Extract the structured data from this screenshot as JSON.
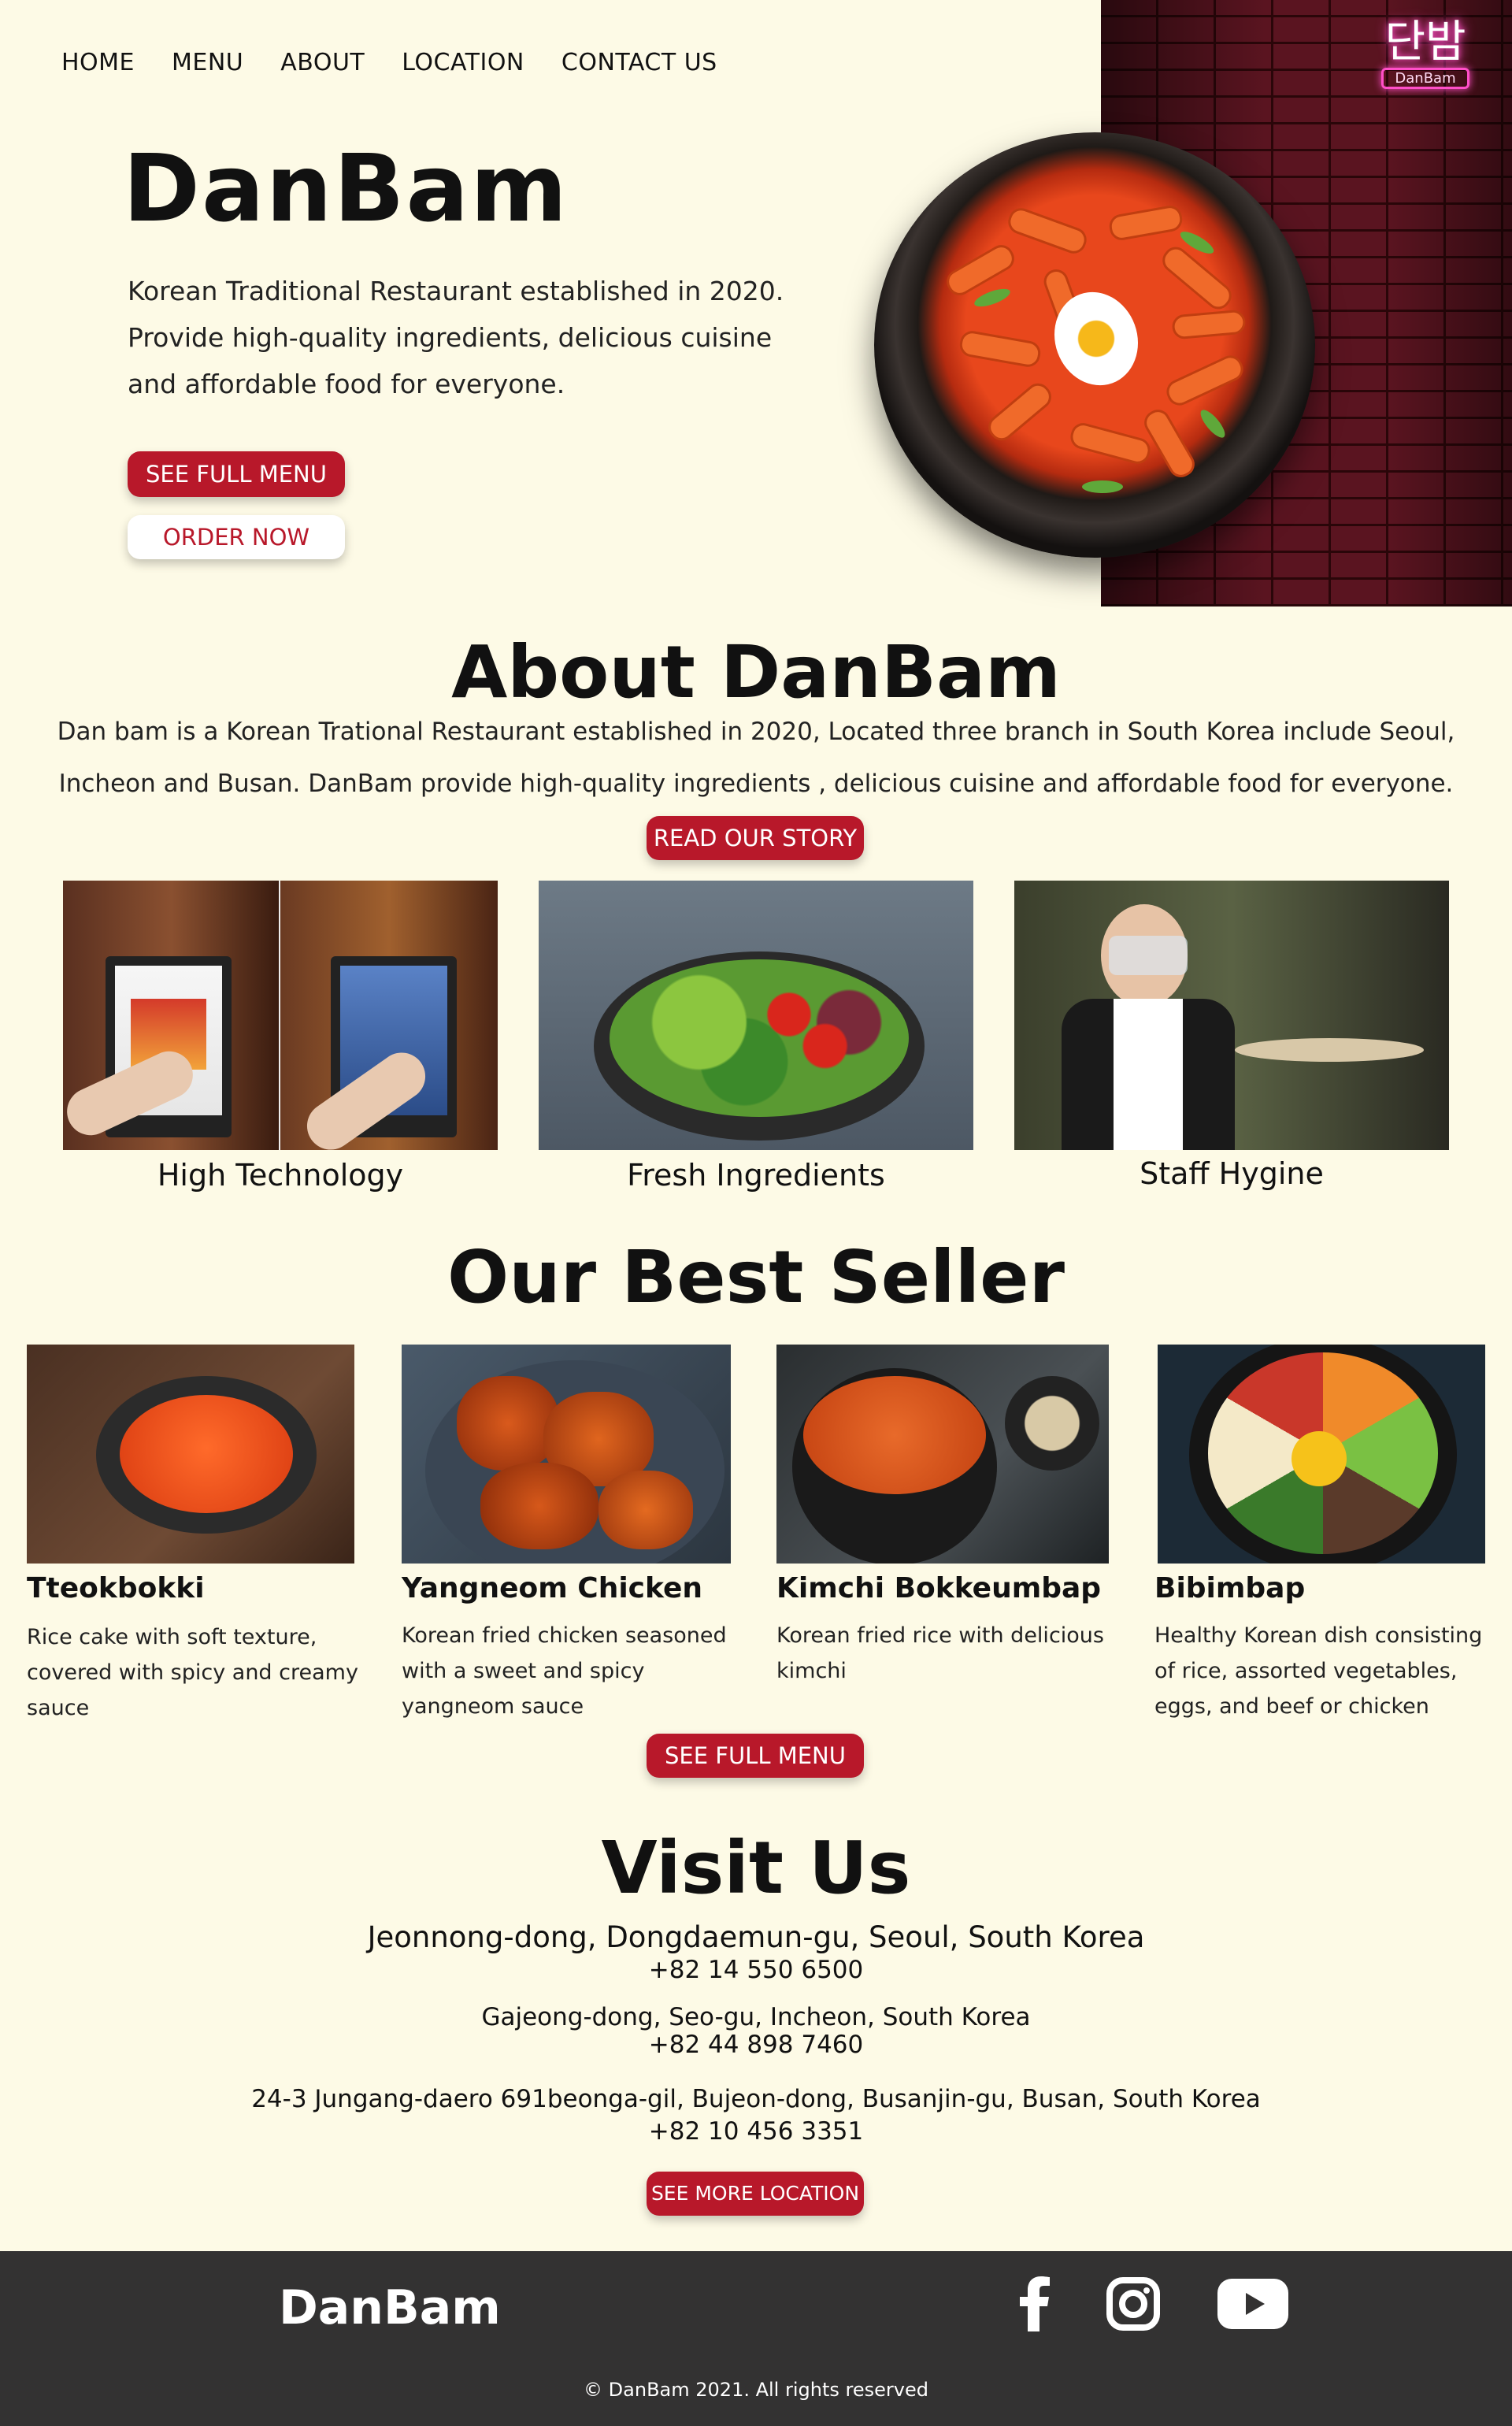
{
  "nav": {
    "items": [
      "HOME",
      "MENU",
      "ABOUT",
      "LOCATION",
      "CONTACT US"
    ]
  },
  "hero": {
    "logo_korean": "단밤",
    "logo_tag": "DanBam",
    "brand": "DanBam",
    "lede": [
      "Korean Traditional Restaurant established in 2020.",
      "Provide high-quality ingredients, delicious cuisine",
      "and affordable food for everyone."
    ],
    "btn_menu": "SEE FULL MENU",
    "btn_order": "ORDER NOW"
  },
  "about": {
    "title": "About DanBam",
    "lines": [
      "Dan bam is a Korean Trational Restaurant established in 2020,  Located three branch in South Korea include Seoul,",
      "Incheon and Busan. DanBam provide high-quality ingredients , delicious cuisine and affordable food for everyone."
    ],
    "btn": "READ OUR STORY",
    "features": [
      "High Technology",
      "Fresh Ingredients",
      "Staff Hygine"
    ]
  },
  "best": {
    "title": "Our Best Seller",
    "items": [
      {
        "name": "Tteokbokki",
        "desc": "Rice cake with soft texture, covered with spicy and creamy sauce"
      },
      {
        "name": "Yangneom Chicken",
        "desc": "Korean fried chicken seasoned with a sweet and spicy yangneom sauce"
      },
      {
        "name": "Kimchi Bokkeumbap",
        "desc": "Korean fried rice with delicious kimchi"
      },
      {
        "name": "Bibimbap",
        "desc": "Healthy Korean dish consisting of rice, assorted vegetables, eggs, and beef or chicken"
      }
    ],
    "btn": "SEE FULL MENU"
  },
  "visit": {
    "title": "Visit Us",
    "locations": [
      {
        "address": "Jeonnong-dong, Dongdaemun-gu, Seoul, South Korea",
        "phone": "+82 14 550 6500"
      },
      {
        "address": "Gajeong-dong, Seo-gu, Incheon, South Korea",
        "phone": "+82 44 898 7460"
      },
      {
        "address": "24-3 Jungang-daero 691beonga-gil, Bujeon-dong, Busanjin-gu, Busan, South Korea",
        "phone": "+82 10 456 3351"
      }
    ],
    "btn": "SEE MORE LOCATION"
  },
  "footer": {
    "brand": "DanBam",
    "copyright": "© DanBam 2021. All rights reserved",
    "social": [
      "facebook-icon",
      "instagram-icon",
      "youtube-icon"
    ]
  }
}
